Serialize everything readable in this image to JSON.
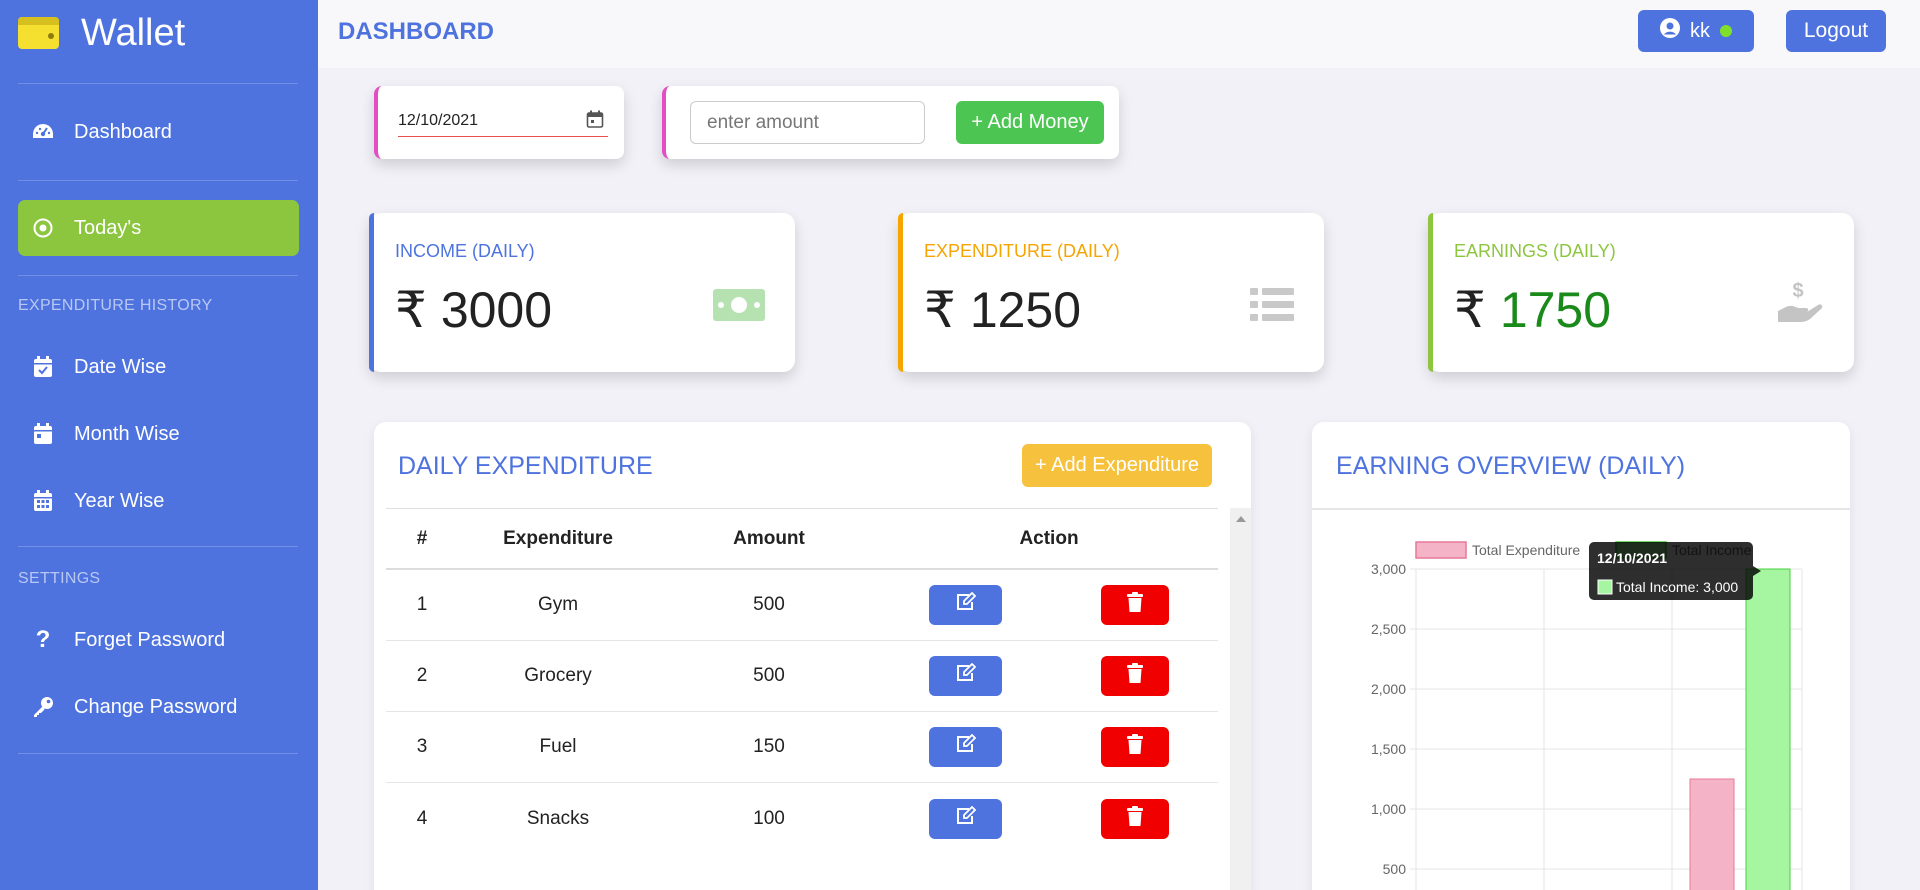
{
  "sidebar": {
    "brand": "Wallet",
    "dashboard": "Dashboard",
    "todays": "Today's",
    "history_heading": "EXPENDITURE HISTORY",
    "date_wise": "Date Wise",
    "month_wise": "Month Wise",
    "year_wise": "Year Wise",
    "settings_heading": "SETTINGS",
    "forget_password": "Forget Password",
    "change_password": "Change Password"
  },
  "header": {
    "title": "DASHBOARD",
    "user": "kk",
    "logout": "Logout"
  },
  "inputs": {
    "date_value": "12/10/2021",
    "amount_placeholder": "enter amount",
    "add_money": "+ Add Money"
  },
  "stats": {
    "income_label": "INCOME (DAILY)",
    "income_currency": "₹",
    "income_value": "3000",
    "expenditure_label": "EXPENDITURE (DAILY)",
    "expenditure_currency": "₹",
    "expenditure_value": "1250",
    "earnings_label": "EARNINGS (DAILY)",
    "earnings_currency": "₹",
    "earnings_value": "1750",
    "colors": {
      "income": "#4e73df",
      "expenditure": "#f6a400",
      "earnings": "#8cc63f",
      "earnings_value": "#1a8a1a"
    }
  },
  "expenditure": {
    "title": "DAILY EXPENDITURE",
    "add_button": "+ Add Expenditure",
    "columns": [
      "#",
      "Expenditure",
      "Amount",
      "Action"
    ],
    "rows": [
      {
        "num": "1",
        "name": "Gym",
        "amount": "500"
      },
      {
        "num": "2",
        "name": "Grocery",
        "amount": "500"
      },
      {
        "num": "3",
        "name": "Fuel",
        "amount": "150"
      },
      {
        "num": "4",
        "name": "Snacks",
        "amount": "100"
      }
    ]
  },
  "overview": {
    "title": "EARNING OVERVIEW (DAILY)",
    "legend": [
      "Total Expenditure",
      "Total Income"
    ],
    "y_ticks": [
      "3,000",
      "2,500",
      "2,000",
      "1,500",
      "1,000",
      "500"
    ],
    "tooltip_title": "12/10/2021",
    "tooltip_text": "Total Income: 3,000"
  },
  "chart_data": {
    "type": "bar",
    "categories": [
      "12/10/2021"
    ],
    "series": [
      {
        "name": "Total Expenditure",
        "values": [
          1250
        ]
      },
      {
        "name": "Total Income",
        "values": [
          3000
        ]
      }
    ],
    "ylim": [
      0,
      3000
    ]
  }
}
